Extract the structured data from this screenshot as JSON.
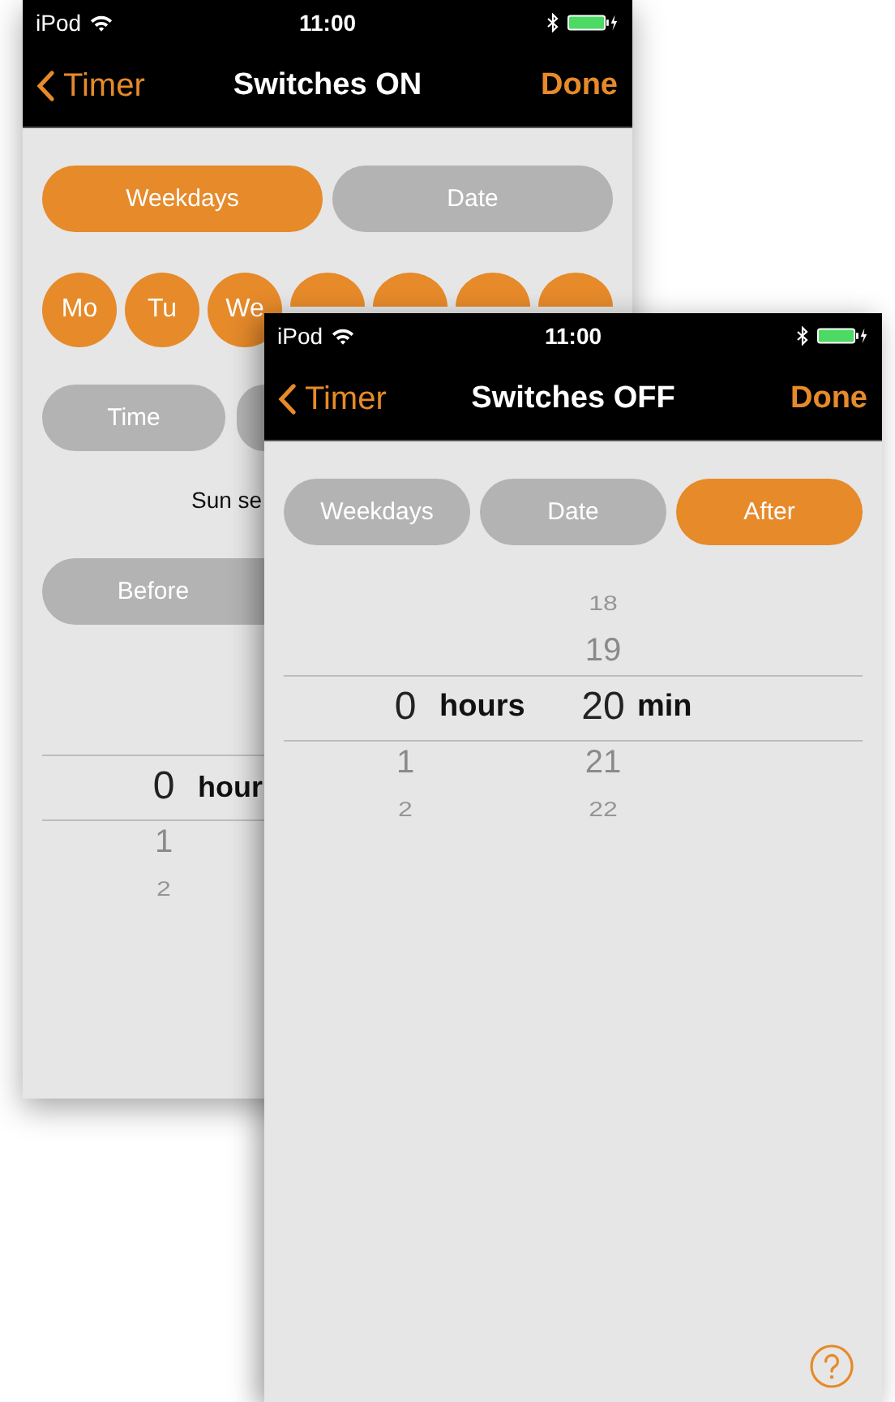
{
  "windows": [
    {
      "status_bar": {
        "carrier": "iPod",
        "time": "11:00"
      },
      "nav": {
        "back": "Timer",
        "title": "Switches ON",
        "done": "Done"
      },
      "modes": [
        {
          "label": "Weekdays",
          "selected": true
        },
        {
          "label": "Date",
          "selected": false
        }
      ],
      "days": [
        {
          "label": "Mo",
          "selected": true
        },
        {
          "label": "Tu",
          "selected": true
        },
        {
          "label": "We",
          "selected": true
        },
        {
          "selected": true
        },
        {
          "selected": true
        },
        {
          "selected": true
        },
        {
          "selected": true
        }
      ],
      "condition_buttons": [
        {
          "label": "Time",
          "selected": false
        },
        {
          "selected": false
        }
      ],
      "sun_note": "Sun se",
      "offset_buttons": [
        {
          "label": "Before",
          "selected": false
        }
      ],
      "picker": {
        "columns": [
          {
            "value": "0",
            "unit": "hour",
            "below": [
              "1",
              "2"
            ]
          }
        ]
      }
    },
    {
      "status_bar": {
        "carrier": "iPod",
        "time": "11:00"
      },
      "nav": {
        "back": "Timer",
        "title": "Switches OFF",
        "done": "Done"
      },
      "modes": [
        {
          "label": "Weekdays",
          "selected": false
        },
        {
          "label": "Date",
          "selected": false
        },
        {
          "label": "After",
          "selected": true
        }
      ],
      "picker": {
        "columns": [
          {
            "value": "0",
            "unit": "hours",
            "below": [
              "1",
              "2"
            ]
          },
          {
            "above": [
              "18",
              "19"
            ],
            "value": "20",
            "unit": "min",
            "below": [
              "21",
              "22"
            ]
          }
        ]
      },
      "help_button": true
    }
  ]
}
